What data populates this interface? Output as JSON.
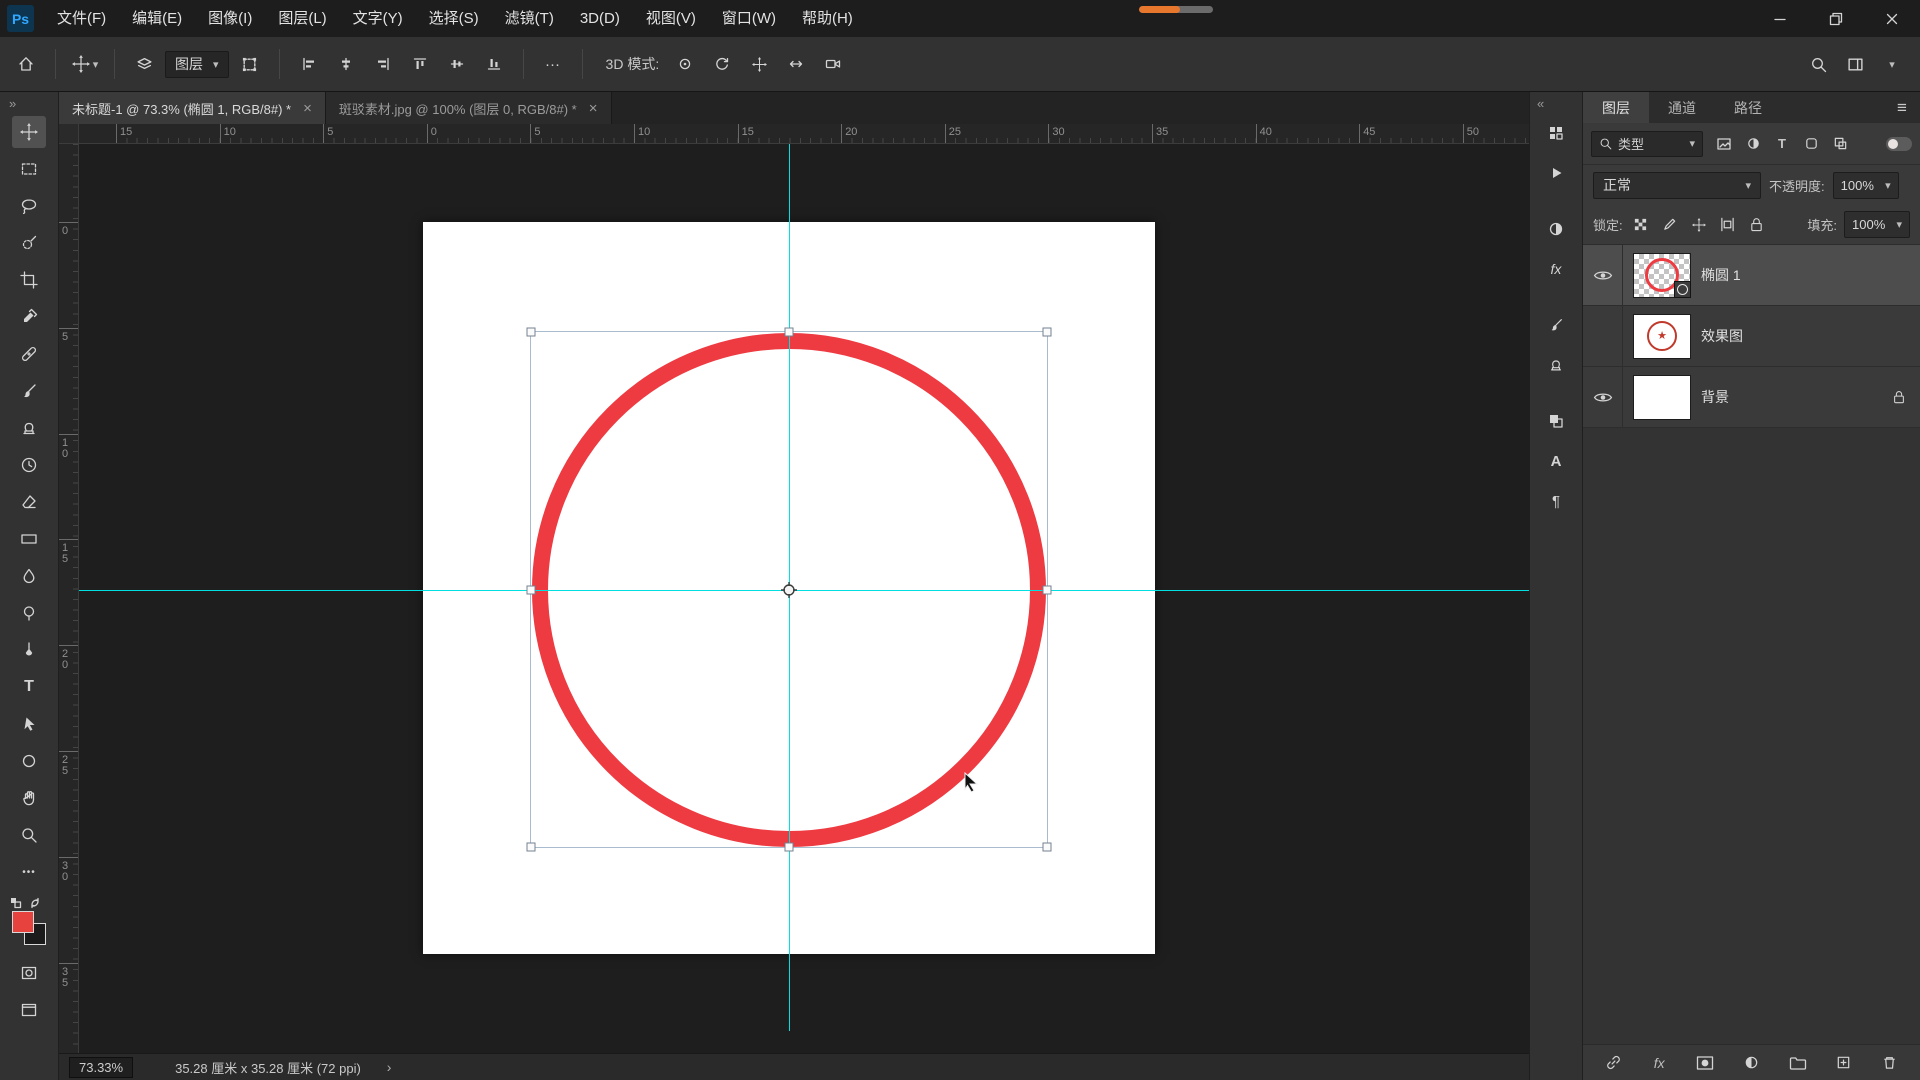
{
  "app": {
    "logo_text": "Ps"
  },
  "colors": {
    "accent_red": "#ee3a41",
    "guide_cyan": "#00e0e0",
    "foreground_swatch": "#e8423e",
    "progress_orange": "#e8772e"
  },
  "menubar": {
    "items": [
      "文件(F)",
      "编辑(E)",
      "图像(I)",
      "图层(L)",
      "文字(Y)",
      "选择(S)",
      "滤镜(T)",
      "3D(D)",
      "视图(V)",
      "窗口(W)",
      "帮助(H)"
    ]
  },
  "icons": {
    "caret_down": "▾",
    "double_chevron_right": "»",
    "double_chevron_left": "«",
    "hamburger": "≡",
    "more_ellipsis": "···",
    "toolbar_more": "•••",
    "close_tab": "×",
    "type_tool": "T",
    "character": "A",
    "paragraph": "¶",
    "fx": "fx",
    "status_chevron": "›",
    "star": "★"
  },
  "options_bar": {
    "layer_select_value": "图层",
    "mode_label": "3D 模式:"
  },
  "document_tabs": [
    {
      "title": "未标题-1 @ 73.3% (椭圆 1, RGB/8#) *"
    },
    {
      "title": "斑驳素材.jpg @ 100% (图层 0, RGB/8#) *"
    }
  ],
  "rulers": {
    "horizontal_labels": [
      "15",
      "10",
      "5",
      "0",
      "5",
      "10",
      "15",
      "20",
      "25",
      "30",
      "35",
      "40",
      "45",
      "50"
    ],
    "vertical_labels": [
      "0",
      "5",
      "10",
      "15",
      "20",
      "25",
      "30",
      "35"
    ]
  },
  "status_bar": {
    "zoom": "73.33%",
    "doc_info": "35.28 厘米 x 35.28 厘米 (72 ppi)"
  },
  "layers_panel": {
    "tabs": [
      "图层",
      "通道",
      "路径"
    ],
    "filter_type_label": "类型",
    "blend_mode_value": "正常",
    "opacity_label": "不透明度:",
    "opacity_value": "100%",
    "lock_label": "锁定:",
    "fill_label": "填充:",
    "fill_value": "100%",
    "layers": [
      {
        "name": "椭圆 1",
        "visible": true,
        "selected": true
      },
      {
        "name": "效果图",
        "visible": false,
        "selected": false
      },
      {
        "name": "背景",
        "visible": true,
        "locked": true,
        "selected": false
      }
    ]
  }
}
